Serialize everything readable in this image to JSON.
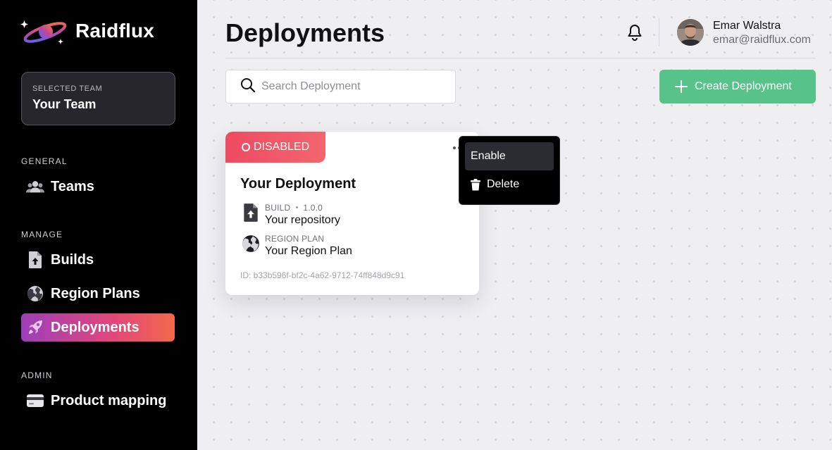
{
  "brand": {
    "name": "Raidflux"
  },
  "sidebar": {
    "team": {
      "caption": "SELECTED TEAM",
      "name": "Your Team"
    },
    "sections": [
      {
        "label": "GENERAL",
        "items": [
          {
            "label": "Teams",
            "icon": "users-icon"
          }
        ]
      },
      {
        "label": "MANAGE",
        "items": [
          {
            "label": "Builds",
            "icon": "file-upload-icon"
          },
          {
            "label": "Region Plans",
            "icon": "globe-icon"
          },
          {
            "label": "Deployments",
            "icon": "rocket-icon",
            "active": true
          }
        ]
      },
      {
        "label": "ADMIN",
        "items": [
          {
            "label": "Product mapping",
            "icon": "credit-card-icon"
          }
        ]
      }
    ],
    "active_gradient": [
      "#9c3fb8",
      "#e4467a",
      "#f1694b"
    ]
  },
  "header": {
    "title": "Deployments",
    "user": {
      "name": "Emar Walstra",
      "email": "emar@raidflux.com"
    }
  },
  "toolbar": {
    "search_placeholder": "Search Deployment",
    "search_value": "",
    "create_label": "Create Deployment",
    "create_color": "#57c28a"
  },
  "deployment_card": {
    "status": "DISABLED",
    "status_color": "#ee4a62",
    "title": "Your Deployment",
    "build": {
      "caption": "BUILD",
      "version": "1.0.0",
      "value": "Your repository"
    },
    "region_plan": {
      "caption": "REGION PLAN",
      "value": "Your Region Plan"
    },
    "id_text": "ID: b33b596f-bf2c-4a62-9712-74ff848d9c91"
  },
  "context_menu": {
    "items": [
      {
        "label": "Enable",
        "icon": null,
        "hovered": true
      },
      {
        "label": "Delete",
        "icon": "trash-icon"
      }
    ]
  }
}
